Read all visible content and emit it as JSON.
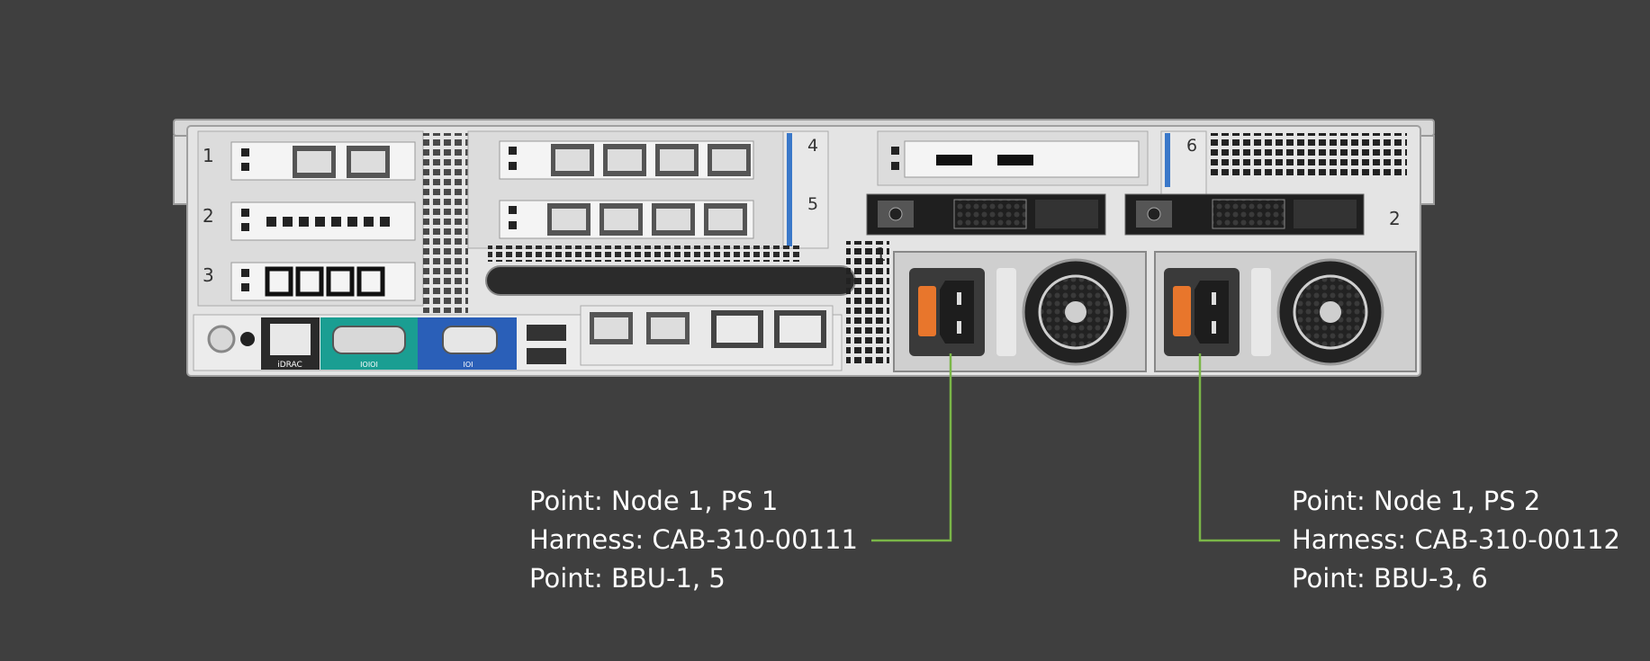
{
  "server": {
    "riser_slots": [
      "1",
      "2",
      "3",
      "4",
      "5",
      "6"
    ],
    "power_supply_numbers": [
      "1",
      "2"
    ],
    "rear_port_labels": {
      "idrac": "iDRAC",
      "serial": "IOIOI",
      "vga": "IOI"
    }
  },
  "callouts": [
    {
      "point_a": "Point: Node 1, PS 1",
      "harness": "Harness: CAB-310-00111",
      "point_b": "Point: BBU-1, 5"
    },
    {
      "point_a": "Point: Node 1, PS 2",
      "harness": "Harness: CAB-310-00112",
      "point_b": "Point: BBU-3, 6"
    }
  ],
  "colors": {
    "background": "#3f3f3f",
    "connector_line": "#7ab648",
    "chassis": "#e4e4e4",
    "psu_latch": "#e8762c",
    "serial_port": "#1a9e92",
    "vga_port": "#2a5fb8",
    "text": "#ffffff"
  }
}
